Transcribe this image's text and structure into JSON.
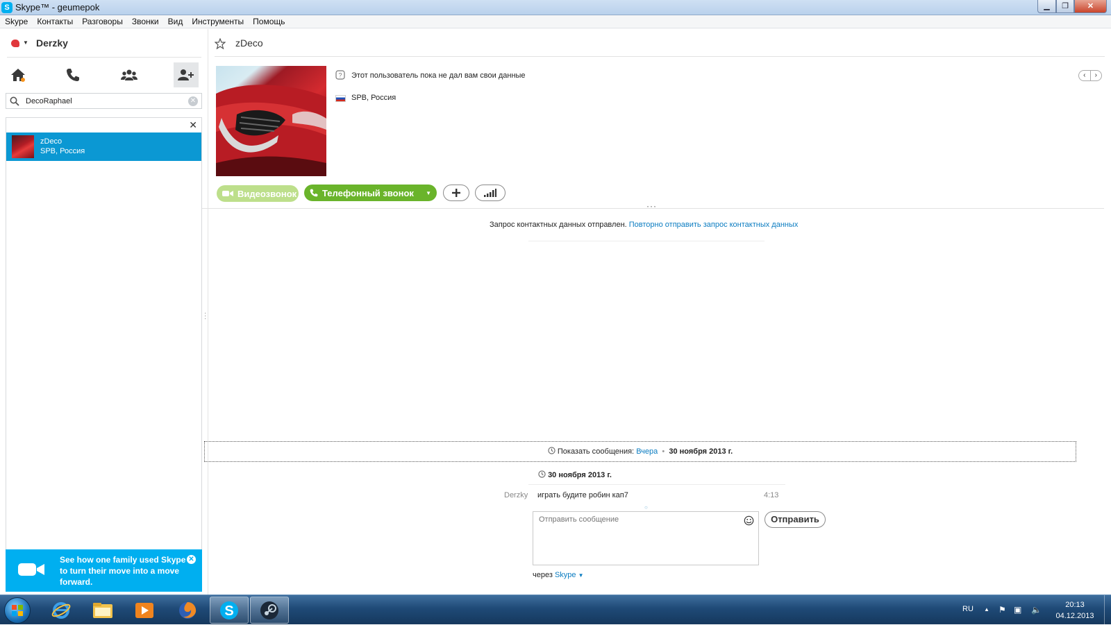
{
  "window": {
    "title": "Skype™ - geumepok",
    "min_label": "▁",
    "max_label": "❐",
    "close_label": "✕"
  },
  "menu": [
    "Skype",
    "Контакты",
    "Разговоры",
    "Звонки",
    "Вид",
    "Инструменты",
    "Помощь"
  ],
  "sidebar": {
    "user_name": "Derzky",
    "nav": [
      "home-icon",
      "phone-icon",
      "group-icon",
      "add-contact-icon"
    ],
    "search": {
      "value": "DecoRaphael",
      "placeholder": ""
    },
    "result": {
      "name": "zDeco",
      "location": "SPB, Россия"
    },
    "close_label": "✕",
    "promo": {
      "text": "See how one family used Skype to turn their move into a move forward.",
      "close_label": "✕"
    }
  },
  "contact": {
    "name": "zDeco",
    "info": "Этот пользователь пока не дал вам свои данные",
    "location": "SPB, Россия",
    "buttons": {
      "video": "Видеозвонок",
      "call": "Телефонный звонок"
    }
  },
  "conversation": {
    "request_text": "Запрос контактных данных отправлен.",
    "request_link": "Повторно отправить запрос контактных данных",
    "history_label": "Показать сообщения:",
    "history_link": "Вчера",
    "history_date": "30 ноября 2013 г.",
    "date_header": "30 ноября 2013 г.",
    "message": {
      "sender": "Derzky",
      "text": "играть будите робин кап7",
      "time": "4:13"
    },
    "compose_placeholder": "Отправить сообщение",
    "send_label": "Отправить",
    "via_label": "через",
    "via_link": "Skype"
  },
  "taskbar": {
    "apps": [
      "ie-icon",
      "explorer-icon",
      "media-player-icon",
      "firefox-icon",
      "skype-icon",
      "steam-icon"
    ],
    "language": "RU",
    "time": "20:13",
    "date": "04.12.2013"
  },
  "colors": {
    "skype_blue": "#00aff0",
    "call_green": "#6ab42b",
    "selection": "#0b98d3",
    "link": "#0a7cc1"
  }
}
